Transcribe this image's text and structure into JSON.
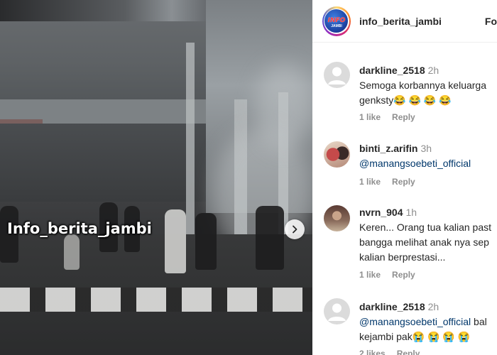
{
  "media": {
    "watermark": "Info_berita_jambi",
    "next_icon": "chevron-right-icon"
  },
  "header": {
    "username": "info_berita_jambi",
    "follow_label": "Fo",
    "logo_text": "INFO",
    "logo_subtext": "JAMBI"
  },
  "comments": [
    {
      "username": "darkline_2518",
      "time": "2h",
      "lines": [
        "Semoga korbannya keluarga",
        "genksty😂 😂 😂 😂"
      ],
      "likes": "1 like",
      "reply": "Reply"
    },
    {
      "username": "binti_z.arifin",
      "time": "3h",
      "mention": "@manangsoebeti_official",
      "likes": "1 like",
      "reply": "Reply"
    },
    {
      "username": "nvrn_904",
      "time": "1h",
      "lines": [
        "Keren... Orang tua kalian past",
        "bangga melihat anak nya sep",
        "kalian berprestasi..."
      ],
      "likes": "1 like",
      "reply": "Reply"
    },
    {
      "username": "darkline_2518",
      "time": "2h",
      "mention": "@manangsoebeti_official",
      "mention_tail": " bal",
      "line2": "kejambi pak😭 😭 😭 😭",
      "likes": "2 likes",
      "reply": "Reply"
    }
  ]
}
